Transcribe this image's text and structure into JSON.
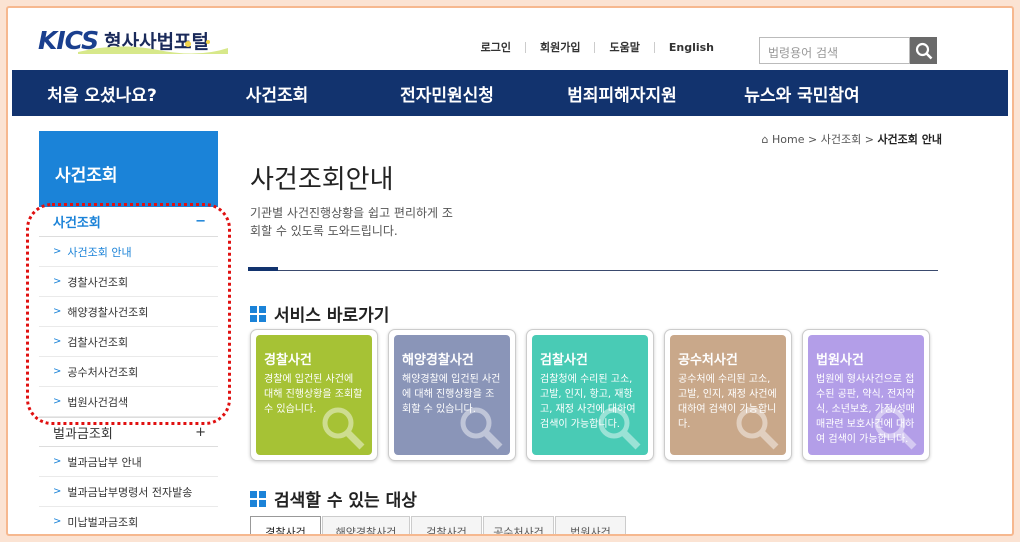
{
  "header": {
    "logo_mark": "KICS",
    "logo_text": "형사사법포털",
    "util": [
      "로그인",
      "회원가입",
      "도움말",
      "English"
    ],
    "search_placeholder": "법령용어 검색"
  },
  "gnb": [
    "처음 오셨나요?",
    "사건조회",
    "전자민원신청",
    "범죄피해자지원",
    "뉴스와 국민참여"
  ],
  "lnb": {
    "title": "사건조회",
    "group1": {
      "label": "사건조회",
      "toggle": "−"
    },
    "items1": [
      "사건조회 안내",
      "경찰사건조회",
      "해양경찰사건조회",
      "검찰사건조회",
      "공수처사건조회",
      "법원사건검색"
    ],
    "group2": {
      "label": "벌과금조회",
      "toggle": "+"
    },
    "items2": [
      "벌과금납부 안내",
      "벌과금납부명령서 전자발송",
      "미납벌과금조회"
    ]
  },
  "breadcrumb": {
    "home": "Home",
    "mid": "사건조회",
    "current": "사건조회 안내"
  },
  "page": {
    "title": "사건조회안내",
    "desc": "기관별 사건진행상황을 쉽고 편리하게 조회할 수 있도록 도와드립니다."
  },
  "services": {
    "title": "서비스 바로가기",
    "cards": [
      {
        "title": "경찰사건",
        "desc": "경찰에 입건된 사건에 대해 진행상황을 조회할 수 있습니다.",
        "color": "#a6c235"
      },
      {
        "title": "해양경찰사건",
        "desc": "해양경찰에 입건된 사건에 대해 진행상황을 조회할 수 있습니다.",
        "color": "#8a95b8"
      },
      {
        "title": "검찰사건",
        "desc": "검찰청에 수리된 고소, 고발, 인지, 항고, 재항고, 재정 사건에 대하여 검색이 가능합니다.",
        "color": "#49cbb5"
      },
      {
        "title": "공수처사건",
        "desc": "공수처에 수리된 고소, 고발, 인지, 재정 사건에 대하여 검색이 가능합니다.",
        "color": "#c9a88a"
      },
      {
        "title": "법원사건",
        "desc": "법원에 형사사건으로 접수된 공판, 약식, 전자약식, 소년보호, 가정/성매매관련 보호사건에 대하여 검색이 가능합니다.",
        "color": "#b39ee8"
      }
    ]
  },
  "targets": {
    "title": "검색할 수 있는 대상",
    "tabs": [
      "경찰사건",
      "해양경찰사건",
      "검찰사건",
      "공수처사건",
      "법원사건"
    ]
  }
}
